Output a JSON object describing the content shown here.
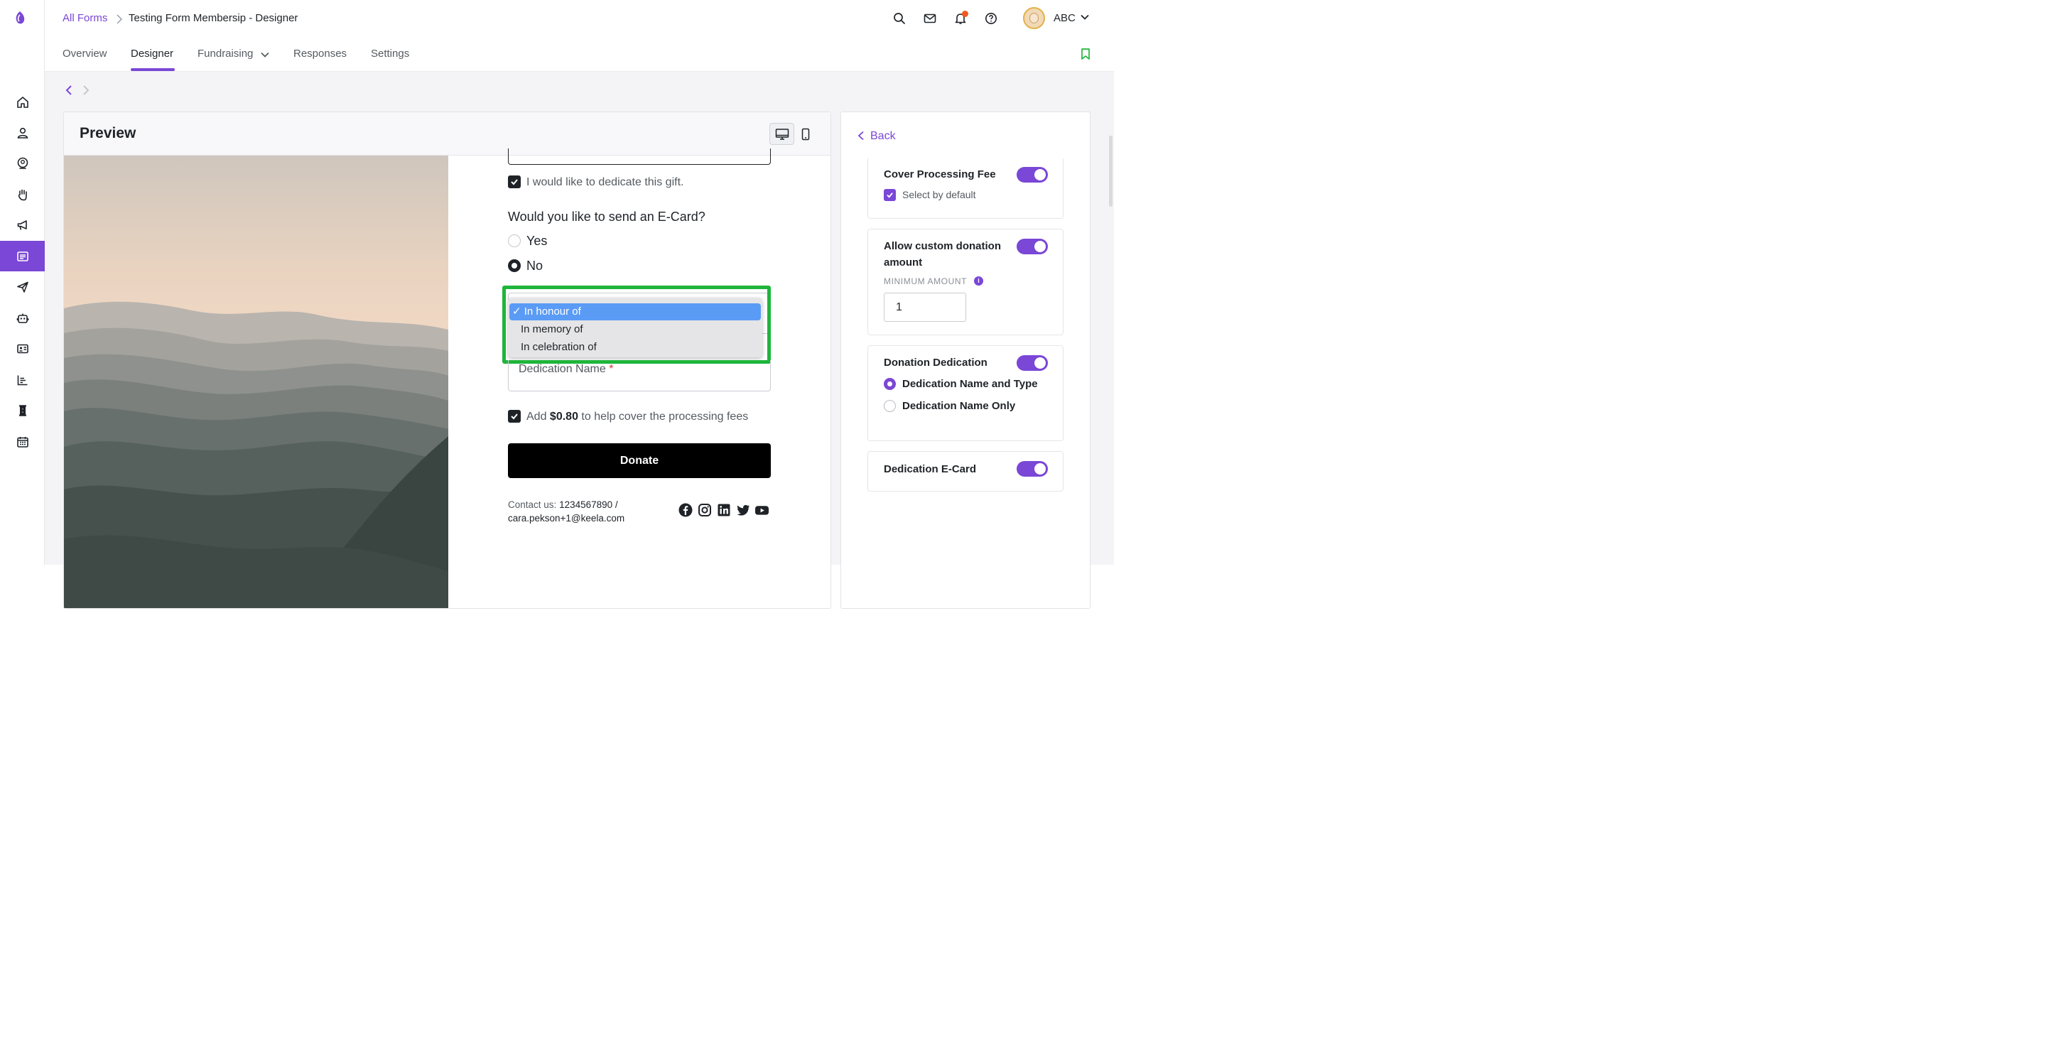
{
  "breadcrumb": {
    "parent": "All Forms",
    "separator": ">",
    "current": "Testing Form Membersip - Designer"
  },
  "user": {
    "name": "ABC"
  },
  "tabs": [
    {
      "label": "Overview"
    },
    {
      "label": "Designer",
      "active": true
    },
    {
      "label": "Fundraising"
    },
    {
      "label": "Responses"
    },
    {
      "label": "Settings"
    }
  ],
  "preview": {
    "title": "Preview",
    "form": {
      "dedicate_label": "I would like to dedicate this gift.",
      "ecard_question": "Would you like to send an E-Card?",
      "ecard_options": [
        "Yes",
        "No"
      ],
      "ecard_selected": "No",
      "dedication_type_options": [
        "In honour of",
        "In memory of",
        "In celebration of"
      ],
      "dedication_type_selected": "In honour of",
      "dedication_type_selected_display": "✓ In honour of",
      "dedication_name_label": "Dedication Name",
      "required_mark": "*",
      "fee_prefix": "Add",
      "fee_amount": "$0.80",
      "fee_suffix": "to help cover the processing fees",
      "donate_label": "Donate",
      "contact_prefix": "Contact us:",
      "contact_phone": "1234567890 /",
      "contact_email": "cara.pekson+1@keela.com"
    }
  },
  "settings_panel": {
    "back_label": "Back",
    "cover_fee": {
      "title": "Cover Processing Fee",
      "enabled": true,
      "select_default_label": "Select by default"
    },
    "custom_amount": {
      "title_line1": "Allow custom donation",
      "title_line2": "amount",
      "enabled": true,
      "min_label": "MINIMUM AMOUNT",
      "min_value": "1",
      "info_glyph": "i"
    },
    "donation_dedication": {
      "title": "Donation Dedication",
      "enabled": true,
      "options": [
        "Dedication Name and Type",
        "Dedication Name Only"
      ],
      "selected": "Dedication Name and Type"
    },
    "dedication_ecard": {
      "title": "Dedication E-Card",
      "enabled": true
    }
  },
  "colors": {
    "brand": "#7a47d6",
    "highlight": "#1fb53b",
    "dropdown_selected": "#5a9bf6",
    "donate_button": "#000000"
  },
  "icons": {
    "rail": [
      "home-icon",
      "person-icon",
      "contact-icon",
      "hand-icon",
      "megaphone-icon",
      "forms-icon",
      "send-icon",
      "robot-icon",
      "id-card-icon",
      "reports-icon",
      "hourglass-icon",
      "calendar-icon"
    ],
    "header": [
      "search-icon",
      "mail-icon",
      "bell-icon",
      "help-icon"
    ],
    "social": [
      "facebook-icon",
      "instagram-icon",
      "linkedin-icon",
      "twitter-icon",
      "youtube-icon"
    ]
  }
}
